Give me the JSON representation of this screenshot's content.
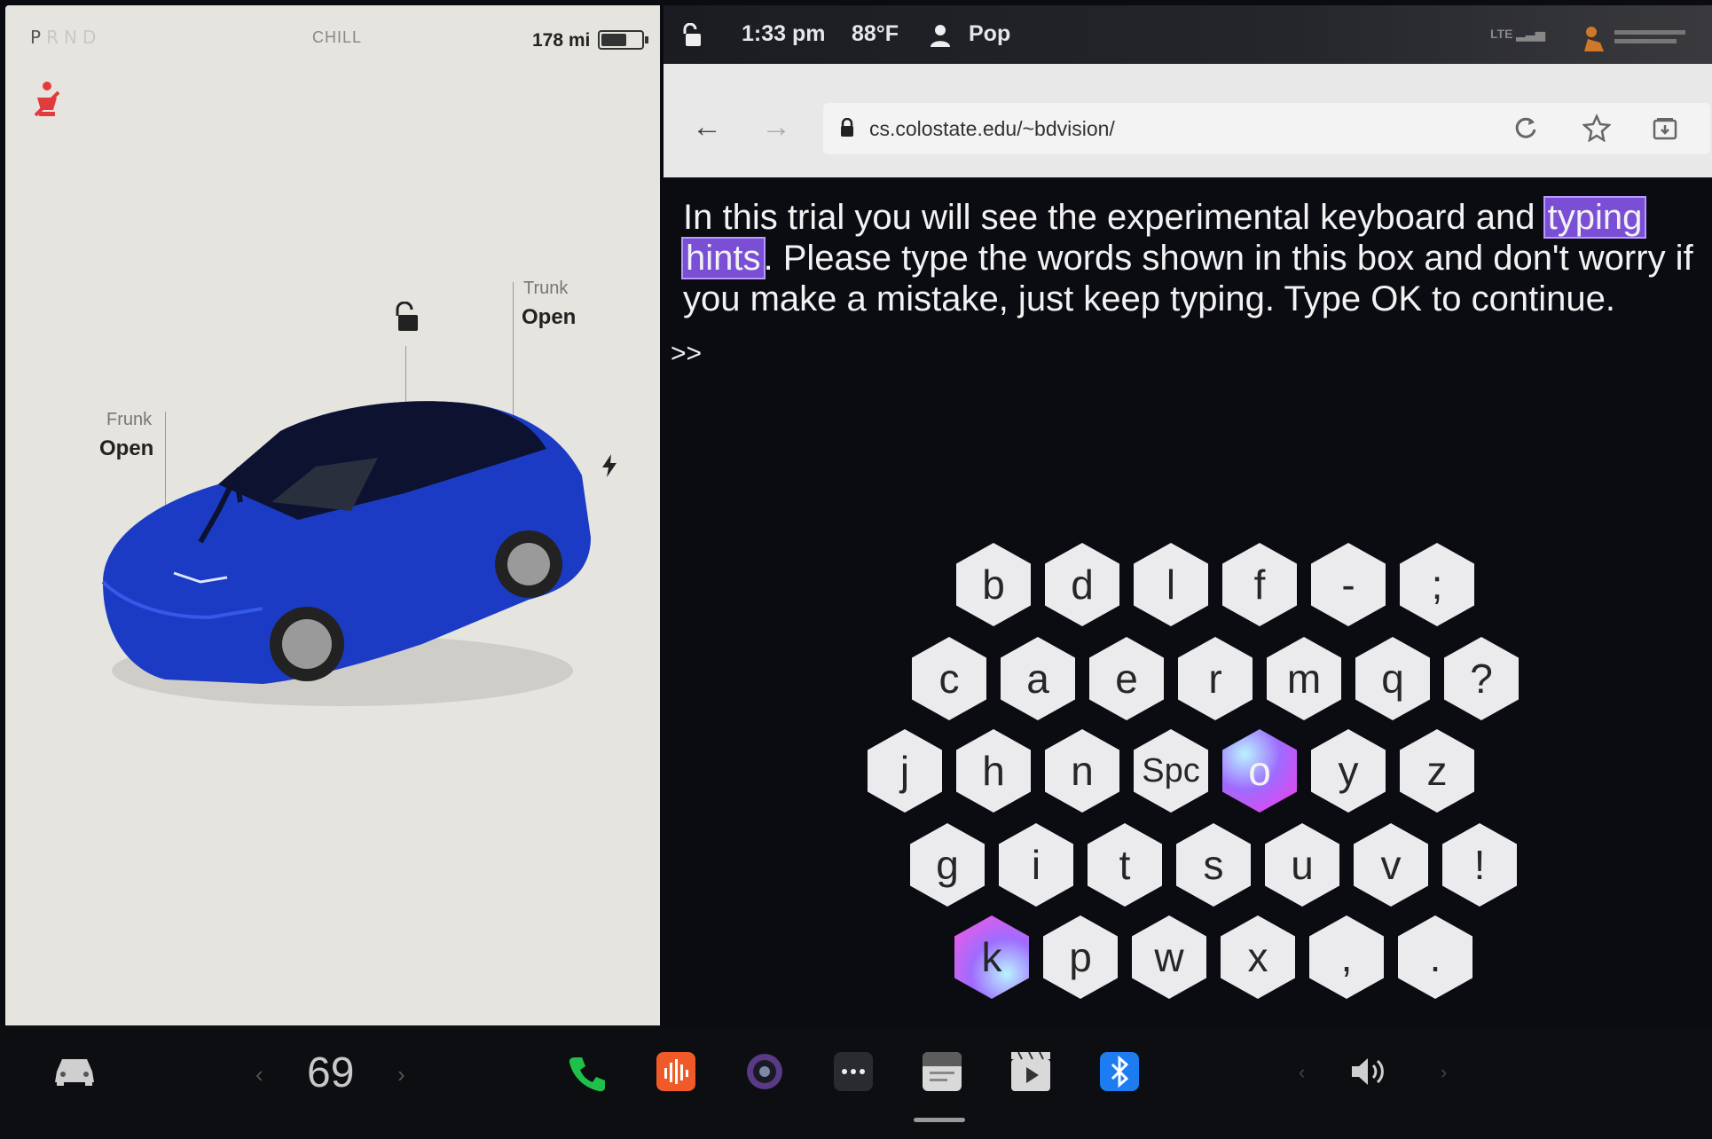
{
  "car_panel": {
    "gear_letters": [
      "P",
      "R",
      "N",
      "D"
    ],
    "drive_mode": "CHILL",
    "range": "178 mi",
    "frunk": {
      "label": "Frunk",
      "value": "Open"
    },
    "trunk": {
      "label": "Trunk",
      "value": "Open"
    },
    "car_color": "#1b3bc4"
  },
  "status_bar": {
    "time": "1:33 pm",
    "outside_temp": "88°F",
    "driver_profile": "Pop",
    "network": "LTE"
  },
  "browser": {
    "url": "cs.colostate.edu/~bdvision/"
  },
  "page": {
    "instruction_part1": "In this trial you will see the experimental keyboard and ",
    "hint_word1": "typing",
    "hint_word2": "hints",
    "instruction_part2": ". Please type the words shown in this box and don't worry if you make a mistake, just keep typing. Type OK to continue.",
    "input_prompt": ">>"
  },
  "keyboard": {
    "rows": [
      [
        "b",
        "d",
        "l",
        "f",
        "-",
        ";"
      ],
      [
        "c",
        "a",
        "e",
        "r",
        "m",
        "q",
        "?"
      ],
      [
        "j",
        "h",
        "n",
        "Spc",
        "o",
        "y",
        "z"
      ],
      [
        "g",
        "i",
        "t",
        "s",
        "u",
        "v",
        "!"
      ],
      [
        "k",
        "p",
        "w",
        "x",
        ",",
        "."
      ]
    ],
    "highlighted_keys": [
      "o",
      "k"
    ]
  },
  "taskbar": {
    "cabin_temperature": "69",
    "icons": [
      "car-icon",
      "phone-icon",
      "music-app-icon",
      "camera-icon",
      "more-apps-icon",
      "calendar-icon",
      "media-player-icon",
      "bluetooth-icon",
      "volume-icon"
    ],
    "accent_colors": {
      "phone": "#1fbf4a",
      "music": "#f05a28",
      "bluetooth": "#1e7cf2"
    }
  }
}
